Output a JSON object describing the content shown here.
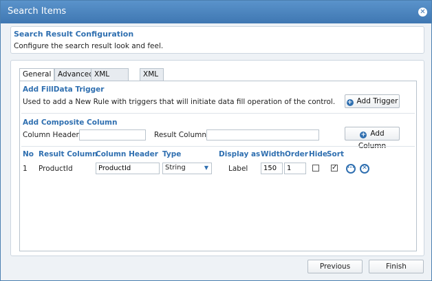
{
  "window": {
    "title": "Search Items"
  },
  "config": {
    "title": "Search Result Configuration",
    "description": "Configure the search result look and feel."
  },
  "tabs": [
    {
      "label": "General"
    },
    {
      "label": "Advanced"
    },
    {
      "label": "XML Mapping"
    },
    {
      "label": "XML Data"
    }
  ],
  "filldata": {
    "title": "Add FillData Trigger",
    "description": "Used to add a New Rule with triggers that will initiate data fill operation of the control.",
    "button": "Add Trigger"
  },
  "composite": {
    "title": "Add Composite Column",
    "column_header_label": "Column Header :",
    "column_header_value": "",
    "result_column_label": "Result Column :",
    "result_column_value": "",
    "button": "Add Column"
  },
  "table": {
    "headers": {
      "no": "No",
      "result_column": "Result Column",
      "column_header": "Column Header",
      "type": "Type",
      "display_as": "Display as",
      "width": "Width",
      "order": "Order",
      "hide": "Hide",
      "sort": "Sort"
    },
    "rows": [
      {
        "no": "1",
        "result_column": "ProductId",
        "column_header": "ProductId",
        "type": "String",
        "display_as": "Label",
        "width": "150",
        "order": "1",
        "hide": false,
        "sort": true
      }
    ]
  },
  "footer": {
    "previous": "Previous",
    "finish": "Finish"
  },
  "colors": {
    "titlebar": "#4d87c0",
    "accent": "#2f6fb0"
  }
}
